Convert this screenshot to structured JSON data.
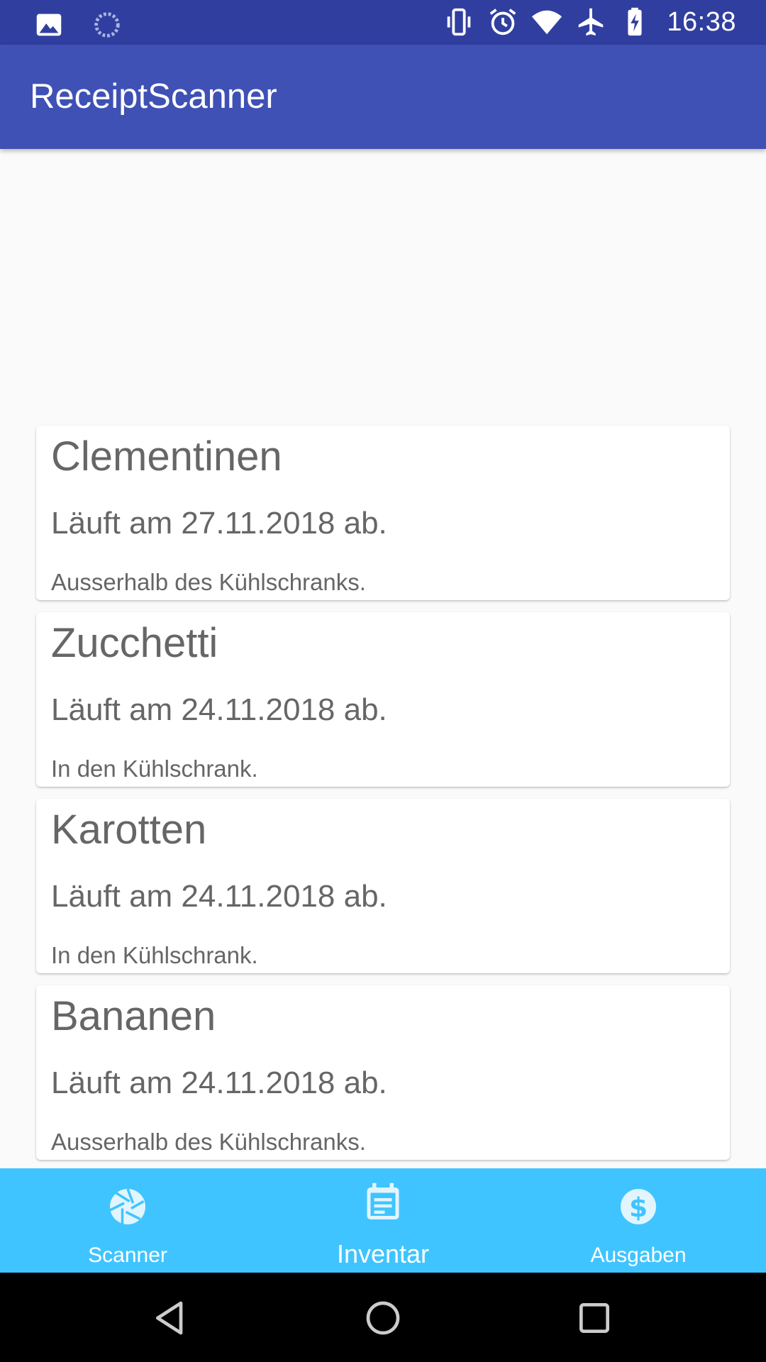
{
  "status_bar": {
    "time": "16:38",
    "left_icons": [
      "image-icon",
      "sync-icon"
    ],
    "right_icons": [
      "vibrate-icon",
      "alarm-icon",
      "wifi-icon",
      "airplane-icon",
      "battery-charging-icon"
    ]
  },
  "app_bar": {
    "title": "ReceiptScanner"
  },
  "items": [
    {
      "name": "Clementinen",
      "expiry": "Läuft am 27.11.2018 ab.",
      "storage": "Ausserhalb des Kühlschranks."
    },
    {
      "name": "Zucchetti",
      "expiry": "Läuft am 24.11.2018 ab.",
      "storage": "In den Kühlschrank."
    },
    {
      "name": "Karotten",
      "expiry": "Läuft am 24.11.2018 ab.",
      "storage": "In den Kühlschrank."
    },
    {
      "name": "Bananen",
      "expiry": "Läuft am 24.11.2018 ab.",
      "storage": "Ausserhalb des Kühlschranks."
    }
  ],
  "bottom_nav": {
    "items": [
      {
        "label": "Scanner",
        "icon": "camera-aperture-icon",
        "active": false
      },
      {
        "label": "Inventar",
        "icon": "calendar-list-icon",
        "active": true
      },
      {
        "label": "Ausgaben",
        "icon": "dollar-icon",
        "active": false
      }
    ]
  },
  "colors": {
    "status_bar": "#303f9f",
    "app_bar": "#3f51b5",
    "bottom_nav": "#40c4ff",
    "card_text": "#666666"
  }
}
